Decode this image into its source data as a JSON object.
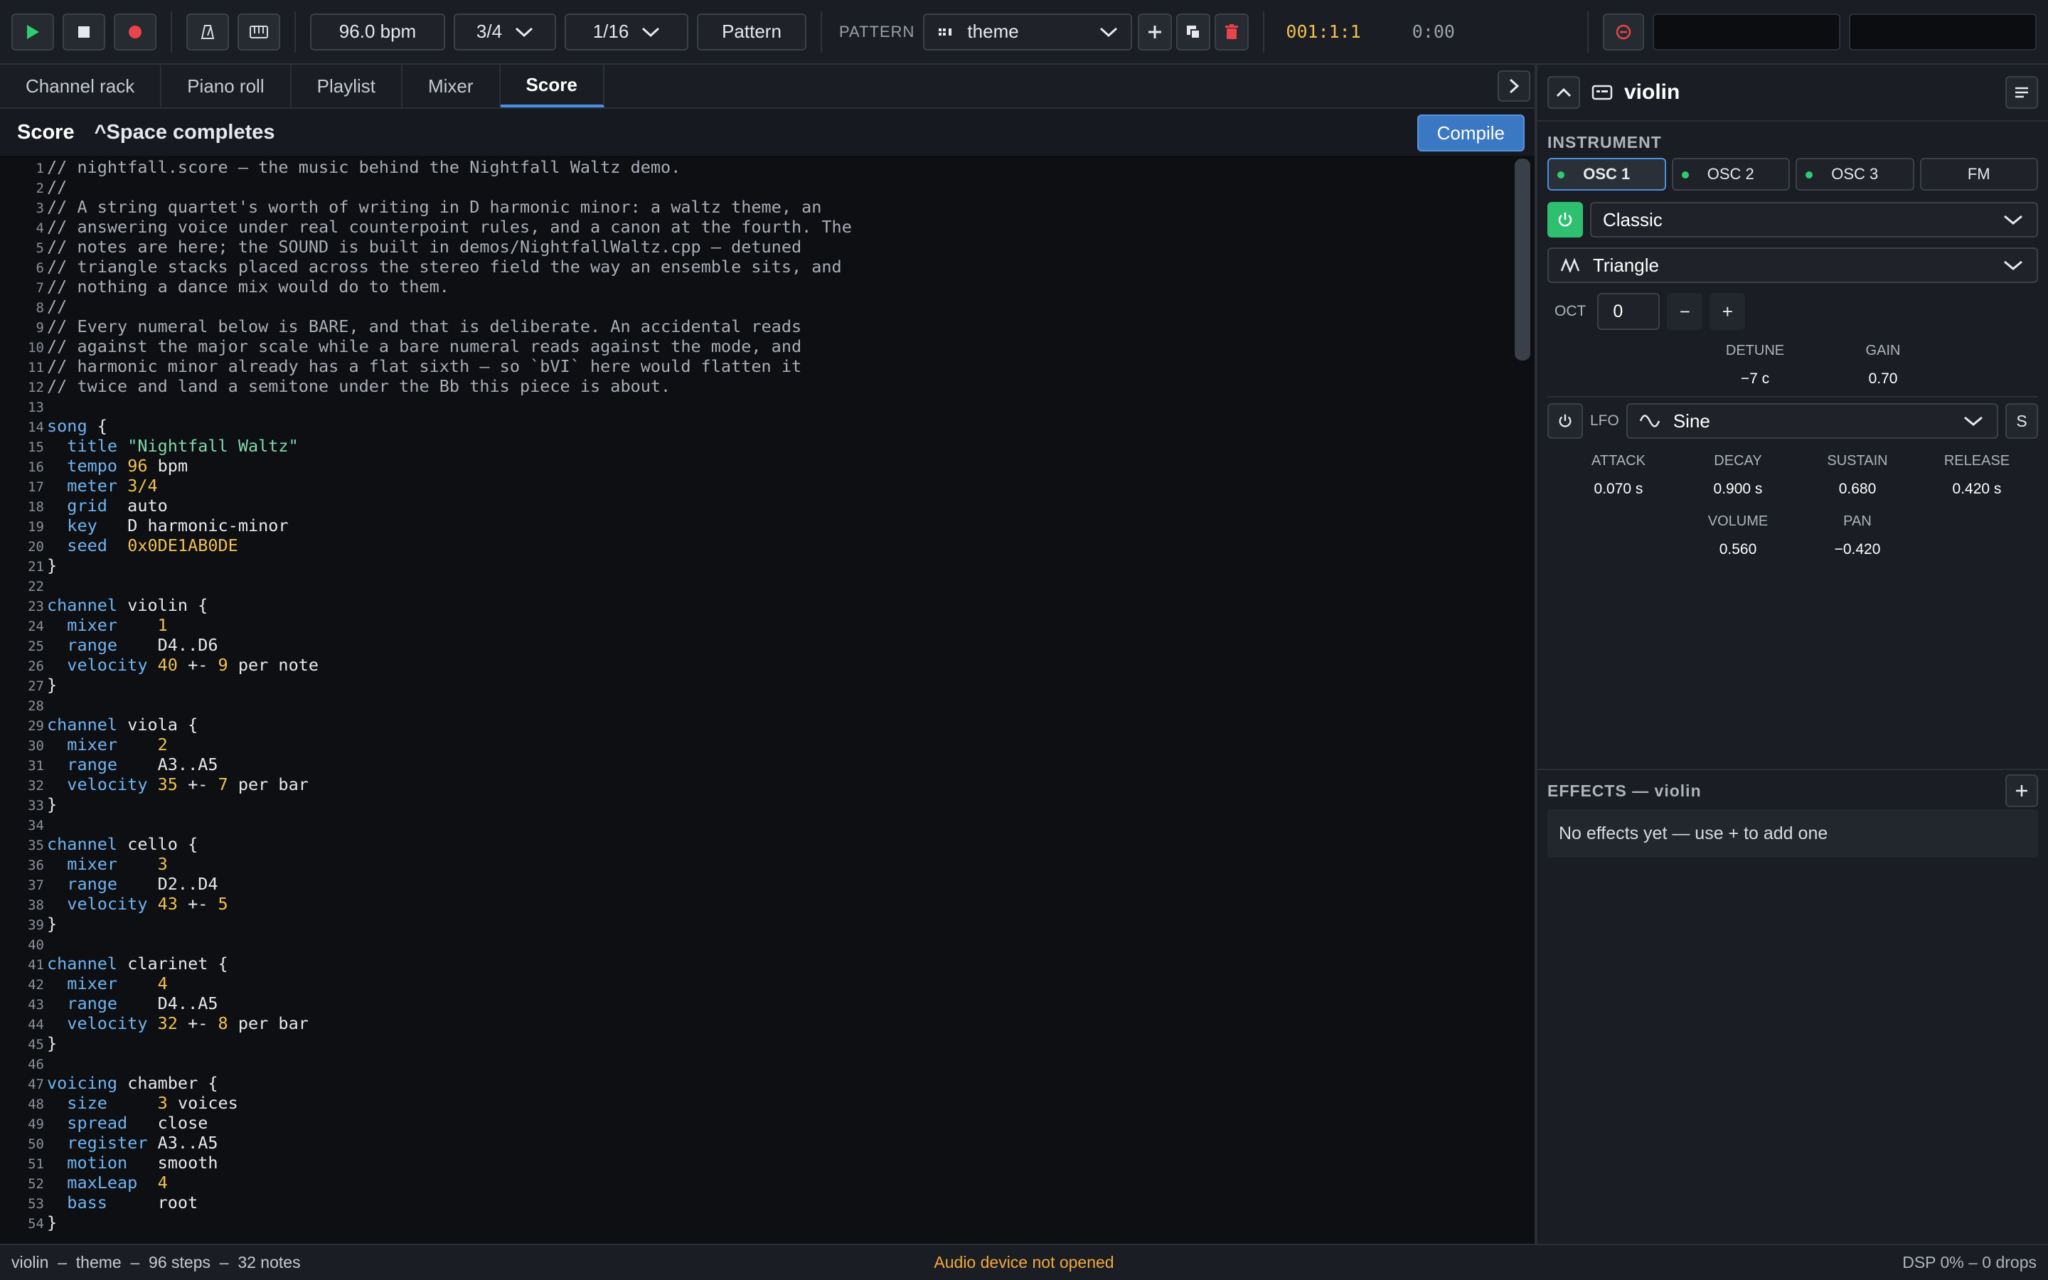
{
  "toolbar": {
    "tempo": "96.0 bpm",
    "meter": "3/4",
    "grid": "1/16",
    "pattern_mode_button": "Pattern",
    "pattern_label": "PATTERN",
    "pattern_name": "theme",
    "position": "001:1:1",
    "time": "0:00",
    "icons": [
      "play-icon",
      "stop-icon",
      "record-icon",
      "metronome-icon",
      "keyboard-icon",
      "chevron-down-icon",
      "plus-icon",
      "duplicate-icon",
      "trash-icon",
      "panic-icon"
    ],
    "colors": {
      "play": "#2ecc71",
      "record": "#e8454a",
      "trash": "#e8454a",
      "position": "#f2c14e"
    }
  },
  "tabs": [
    "Channel rack",
    "Piano roll",
    "Playlist",
    "Mixer",
    "Score"
  ],
  "active_tab": "Score",
  "editor": {
    "title": "Score",
    "hint": "^Space completes",
    "compile_label": "Compile"
  },
  "code_lines": [
    [
      [
        "c",
        "// nightfall.score — the music behind the Nightfall Waltz demo."
      ]
    ],
    [
      [
        "c",
        "//"
      ]
    ],
    [
      [
        "c",
        "// A string quartet's worth of writing in D harmonic minor: a waltz theme, an"
      ]
    ],
    [
      [
        "c",
        "// answering voice under real counterpoint rules, and a canon at the fourth. The"
      ]
    ],
    [
      [
        "c",
        "// notes are here; the SOUND is built in demos/NightfallWaltz.cpp — detuned"
      ]
    ],
    [
      [
        "c",
        "// triangle stacks placed across the stereo field the way an ensemble sits, and"
      ]
    ],
    [
      [
        "c",
        "// nothing a dance mix would do to them."
      ]
    ],
    [
      [
        "c",
        "//"
      ]
    ],
    [
      [
        "c",
        "// Every numeral below is BARE, and that is deliberate. An accidental reads"
      ]
    ],
    [
      [
        "c",
        "// against the major scale while a bare numeral reads against the mode, and"
      ]
    ],
    [
      [
        "c",
        "// harmonic minor already has a flat sixth — so `bVI` here would flatten it"
      ]
    ],
    [
      [
        "c",
        "// twice and land a semitone under the Bb this piece is about."
      ]
    ],
    [],
    [
      [
        "k",
        "song"
      ],
      [
        "t",
        " {"
      ]
    ],
    [
      [
        "t",
        "  "
      ],
      [
        "k",
        "title"
      ],
      [
        "t",
        " "
      ],
      [
        "s",
        "\"Nightfall Waltz\""
      ]
    ],
    [
      [
        "t",
        "  "
      ],
      [
        "k",
        "tempo"
      ],
      [
        "t",
        " "
      ],
      [
        "n",
        "96"
      ],
      [
        "t",
        " bpm"
      ]
    ],
    [
      [
        "t",
        "  "
      ],
      [
        "k",
        "meter"
      ],
      [
        "t",
        " "
      ],
      [
        "n",
        "3/4"
      ]
    ],
    [
      [
        "t",
        "  "
      ],
      [
        "k",
        "grid"
      ],
      [
        "t",
        "  auto"
      ]
    ],
    [
      [
        "t",
        "  "
      ],
      [
        "k",
        "key"
      ],
      [
        "t",
        "   D harmonic-minor"
      ]
    ],
    [
      [
        "t",
        "  "
      ],
      [
        "k",
        "seed"
      ],
      [
        "t",
        "  "
      ],
      [
        "n",
        "0x0DE1AB0DE"
      ]
    ],
    [
      [
        "t",
        "}"
      ]
    ],
    [],
    [
      [
        "k",
        "channel"
      ],
      [
        "t",
        " violin {"
      ]
    ],
    [
      [
        "t",
        "  "
      ],
      [
        "k",
        "mixer"
      ],
      [
        "t",
        "    "
      ],
      [
        "n",
        "1"
      ]
    ],
    [
      [
        "t",
        "  "
      ],
      [
        "k",
        "range"
      ],
      [
        "t",
        "    D4..D6"
      ]
    ],
    [
      [
        "t",
        "  "
      ],
      [
        "k",
        "velocity"
      ],
      [
        "t",
        " "
      ],
      [
        "n",
        "40"
      ],
      [
        "t",
        " +- "
      ],
      [
        "n",
        "9"
      ],
      [
        "t",
        " per note"
      ]
    ],
    [
      [
        "t",
        "}"
      ]
    ],
    [],
    [
      [
        "k",
        "channel"
      ],
      [
        "t",
        " viola {"
      ]
    ],
    [
      [
        "t",
        "  "
      ],
      [
        "k",
        "mixer"
      ],
      [
        "t",
        "    "
      ],
      [
        "n",
        "2"
      ]
    ],
    [
      [
        "t",
        "  "
      ],
      [
        "k",
        "range"
      ],
      [
        "t",
        "    A3..A5"
      ]
    ],
    [
      [
        "t",
        "  "
      ],
      [
        "k",
        "velocity"
      ],
      [
        "t",
        " "
      ],
      [
        "n",
        "35"
      ],
      [
        "t",
        " +- "
      ],
      [
        "n",
        "7"
      ],
      [
        "t",
        " per bar"
      ]
    ],
    [
      [
        "t",
        "}"
      ]
    ],
    [],
    [
      [
        "k",
        "channel"
      ],
      [
        "t",
        " cello {"
      ]
    ],
    [
      [
        "t",
        "  "
      ],
      [
        "k",
        "mixer"
      ],
      [
        "t",
        "    "
      ],
      [
        "n",
        "3"
      ]
    ],
    [
      [
        "t",
        "  "
      ],
      [
        "k",
        "range"
      ],
      [
        "t",
        "    D2..D4"
      ]
    ],
    [
      [
        "t",
        "  "
      ],
      [
        "k",
        "velocity"
      ],
      [
        "t",
        " "
      ],
      [
        "n",
        "43"
      ],
      [
        "t",
        " +- "
      ],
      [
        "n",
        "5"
      ]
    ],
    [
      [
        "t",
        "}"
      ]
    ],
    [],
    [
      [
        "k",
        "channel"
      ],
      [
        "t",
        " clarinet {"
      ]
    ],
    [
      [
        "t",
        "  "
      ],
      [
        "k",
        "mixer"
      ],
      [
        "t",
        "    "
      ],
      [
        "n",
        "4"
      ]
    ],
    [
      [
        "t",
        "  "
      ],
      [
        "k",
        "range"
      ],
      [
        "t",
        "    D4..A5"
      ]
    ],
    [
      [
        "t",
        "  "
      ],
      [
        "k",
        "velocity"
      ],
      [
        "t",
        " "
      ],
      [
        "n",
        "32"
      ],
      [
        "t",
        " +- "
      ],
      [
        "n",
        "8"
      ],
      [
        "t",
        " per bar"
      ]
    ],
    [
      [
        "t",
        "}"
      ]
    ],
    [],
    [
      [
        "k",
        "voicing"
      ],
      [
        "t",
        " chamber {"
      ]
    ],
    [
      [
        "t",
        "  "
      ],
      [
        "k",
        "size"
      ],
      [
        "t",
        "     "
      ],
      [
        "n",
        "3"
      ],
      [
        "t",
        " voices"
      ]
    ],
    [
      [
        "t",
        "  "
      ],
      [
        "k",
        "spread"
      ],
      [
        "t",
        "   close"
      ]
    ],
    [
      [
        "t",
        "  "
      ],
      [
        "k",
        "register"
      ],
      [
        "t",
        " A3..A5"
      ]
    ],
    [
      [
        "t",
        "  "
      ],
      [
        "k",
        "motion"
      ],
      [
        "t",
        "   smooth"
      ]
    ],
    [
      [
        "t",
        "  "
      ],
      [
        "k",
        "maxLeap"
      ],
      [
        "t",
        "  "
      ],
      [
        "n",
        "4"
      ]
    ],
    [
      [
        "t",
        "  "
      ],
      [
        "k",
        "bass"
      ],
      [
        "t",
        "     root"
      ]
    ],
    [
      [
        "t",
        "}"
      ]
    ]
  ],
  "instrument": {
    "name": "violin",
    "section_label": "INSTRUMENT",
    "osc_tabs": [
      {
        "label": "OSC 1",
        "dot": true,
        "active": true
      },
      {
        "label": "OSC 2",
        "dot": true,
        "active": false
      },
      {
        "label": "OSC 3",
        "dot": true,
        "active": false
      },
      {
        "label": "FM",
        "dot": false,
        "active": false
      }
    ],
    "engine": "Classic",
    "waveform": "Triangle",
    "oct_label": "OCT",
    "oct_value": "0",
    "oct_minus": "−",
    "oct_plus": "+",
    "detune": {
      "label": "DETUNE",
      "value": "−7 c",
      "level": 0.48,
      "color": "#e87a8a"
    },
    "gain": {
      "label": "GAIN",
      "value": "0.70",
      "level": 0.7,
      "color": "#4a9ef0"
    },
    "lfo": {
      "label": "LFO",
      "shape": "Sine",
      "s_label": "S"
    },
    "envelope": [
      {
        "label": "ATTACK",
        "value": "0.070 s",
        "level": 0.07,
        "color": "#c5d17a"
      },
      {
        "label": "DECAY",
        "value": "0.900 s",
        "level": 0.45,
        "color": "#c5d17a"
      },
      {
        "label": "SUSTAIN",
        "value": "0.680",
        "level": 0.68,
        "color": "#4a9ef0"
      },
      {
        "label": "RELEASE",
        "value": "0.420 s",
        "level": 0.42,
        "color": "#c5d17a"
      }
    ],
    "volume": {
      "label": "VOLUME",
      "value": "0.560",
      "level": 0.56,
      "color": "#4a9ef0"
    },
    "pan": {
      "label": "PAN",
      "value": "−0.420",
      "level": 0.29,
      "color": "#7fd1c7"
    }
  },
  "effects": {
    "title": "EFFECTS — violin",
    "empty": "No effects yet — use + to add one"
  },
  "status": {
    "left": "violin  –  theme  –  96 steps  –  32 notes",
    "center": "Audio device not opened",
    "right": "DSP 0%  –  0 drops"
  }
}
